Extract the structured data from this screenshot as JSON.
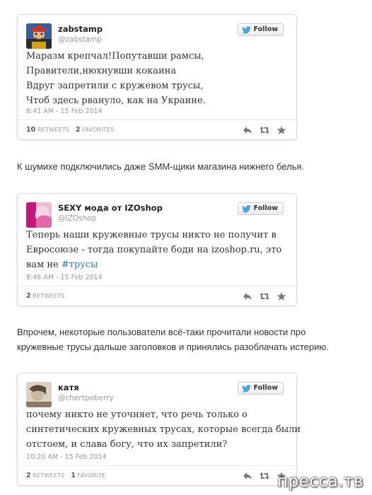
{
  "tweets": [
    {
      "name": "zabstamp",
      "handle": "@zabstamp",
      "follow_label": "Follow",
      "lines": [
        "Маразм крепчал!Попутавши рамсы,",
        "Правители,нюхнувши кокаина",
        "Вдруг запретили с кружевом трусы,",
        "Чтоб здесь рвануло, как на Украине."
      ],
      "timestamp": "8:41 AM - 15 Feb 2014",
      "retweets_count": "10",
      "retweets_label": "RETWEETS",
      "favorites_count": "2",
      "favorites_label": "FAVORITES"
    },
    {
      "name": "SEXY мода от IZOshop",
      "handle": "@IZOshop",
      "follow_label": "Follow",
      "lines": [
        "Теперь наши кружевные трусы никто не получит в",
        "Евросоюзе - тогда покупайте боди на izoshop.ru, это"
      ],
      "last_line_prefix": "вам не ",
      "hashtag": "#трусы",
      "timestamp": "8:46 AM - 15 Feb 2014",
      "retweets_count": "2",
      "retweets_label": "RETWEETS"
    },
    {
      "name": "катя",
      "handle": "@chertpoberry",
      "follow_label": "Follow",
      "lines": [
        "почему никто не уточняет, что речь только о",
        "синтетических кружевных трусах, которые всегда были",
        "отстоем, и слава богу, что их запретили?"
      ],
      "timestamp": "10:20 AM - 15 Feb 2014",
      "retweets_count": "2",
      "retweets_label": "RETWEETS",
      "favorites_count": "1",
      "favorites_label": "FAVORITE"
    }
  ],
  "captions": {
    "first": "К шумихе подключились даже SMM-щики магазина нижнего белья.",
    "second_line1": "Впрочем, некоторые пользователи всё-таки прочитали новости про",
    "second_line2": "кружевные трусы дальше заголовков и принялись разоблачать истерию."
  },
  "watermark": "пресса.тв",
  "colors": {
    "link": "#2b7bb9",
    "twitter_bird": "#4ba2d7",
    "muted": "#999999"
  },
  "icons": {
    "follow": "twitter-bird-icon",
    "reply": "reply-icon",
    "retweet": "retweet-icon",
    "favorite": "star-icon"
  }
}
